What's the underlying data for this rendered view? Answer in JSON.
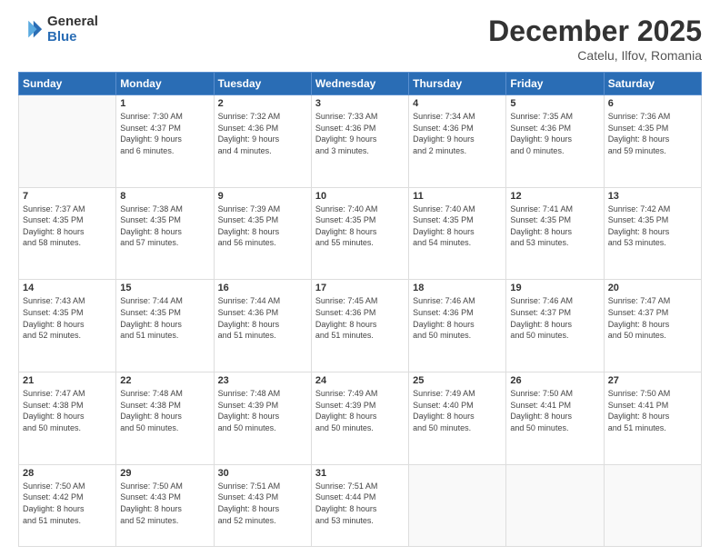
{
  "header": {
    "logo_general": "General",
    "logo_blue": "Blue",
    "month_title": "December 2025",
    "location": "Catelu, Ilfov, Romania"
  },
  "days_of_week": [
    "Sunday",
    "Monday",
    "Tuesday",
    "Wednesday",
    "Thursday",
    "Friday",
    "Saturday"
  ],
  "weeks": [
    [
      {
        "day": "",
        "info": ""
      },
      {
        "day": "1",
        "info": "Sunrise: 7:30 AM\nSunset: 4:37 PM\nDaylight: 9 hours\nand 6 minutes."
      },
      {
        "day": "2",
        "info": "Sunrise: 7:32 AM\nSunset: 4:36 PM\nDaylight: 9 hours\nand 4 minutes."
      },
      {
        "day": "3",
        "info": "Sunrise: 7:33 AM\nSunset: 4:36 PM\nDaylight: 9 hours\nand 3 minutes."
      },
      {
        "day": "4",
        "info": "Sunrise: 7:34 AM\nSunset: 4:36 PM\nDaylight: 9 hours\nand 2 minutes."
      },
      {
        "day": "5",
        "info": "Sunrise: 7:35 AM\nSunset: 4:36 PM\nDaylight: 9 hours\nand 0 minutes."
      },
      {
        "day": "6",
        "info": "Sunrise: 7:36 AM\nSunset: 4:35 PM\nDaylight: 8 hours\nand 59 minutes."
      }
    ],
    [
      {
        "day": "7",
        "info": "Sunrise: 7:37 AM\nSunset: 4:35 PM\nDaylight: 8 hours\nand 58 minutes."
      },
      {
        "day": "8",
        "info": "Sunrise: 7:38 AM\nSunset: 4:35 PM\nDaylight: 8 hours\nand 57 minutes."
      },
      {
        "day": "9",
        "info": "Sunrise: 7:39 AM\nSunset: 4:35 PM\nDaylight: 8 hours\nand 56 minutes."
      },
      {
        "day": "10",
        "info": "Sunrise: 7:40 AM\nSunset: 4:35 PM\nDaylight: 8 hours\nand 55 minutes."
      },
      {
        "day": "11",
        "info": "Sunrise: 7:40 AM\nSunset: 4:35 PM\nDaylight: 8 hours\nand 54 minutes."
      },
      {
        "day": "12",
        "info": "Sunrise: 7:41 AM\nSunset: 4:35 PM\nDaylight: 8 hours\nand 53 minutes."
      },
      {
        "day": "13",
        "info": "Sunrise: 7:42 AM\nSunset: 4:35 PM\nDaylight: 8 hours\nand 53 minutes."
      }
    ],
    [
      {
        "day": "14",
        "info": "Sunrise: 7:43 AM\nSunset: 4:35 PM\nDaylight: 8 hours\nand 52 minutes."
      },
      {
        "day": "15",
        "info": "Sunrise: 7:44 AM\nSunset: 4:35 PM\nDaylight: 8 hours\nand 51 minutes."
      },
      {
        "day": "16",
        "info": "Sunrise: 7:44 AM\nSunset: 4:36 PM\nDaylight: 8 hours\nand 51 minutes."
      },
      {
        "day": "17",
        "info": "Sunrise: 7:45 AM\nSunset: 4:36 PM\nDaylight: 8 hours\nand 51 minutes."
      },
      {
        "day": "18",
        "info": "Sunrise: 7:46 AM\nSunset: 4:36 PM\nDaylight: 8 hours\nand 50 minutes."
      },
      {
        "day": "19",
        "info": "Sunrise: 7:46 AM\nSunset: 4:37 PM\nDaylight: 8 hours\nand 50 minutes."
      },
      {
        "day": "20",
        "info": "Sunrise: 7:47 AM\nSunset: 4:37 PM\nDaylight: 8 hours\nand 50 minutes."
      }
    ],
    [
      {
        "day": "21",
        "info": "Sunrise: 7:47 AM\nSunset: 4:38 PM\nDaylight: 8 hours\nand 50 minutes."
      },
      {
        "day": "22",
        "info": "Sunrise: 7:48 AM\nSunset: 4:38 PM\nDaylight: 8 hours\nand 50 minutes."
      },
      {
        "day": "23",
        "info": "Sunrise: 7:48 AM\nSunset: 4:39 PM\nDaylight: 8 hours\nand 50 minutes."
      },
      {
        "day": "24",
        "info": "Sunrise: 7:49 AM\nSunset: 4:39 PM\nDaylight: 8 hours\nand 50 minutes."
      },
      {
        "day": "25",
        "info": "Sunrise: 7:49 AM\nSunset: 4:40 PM\nDaylight: 8 hours\nand 50 minutes."
      },
      {
        "day": "26",
        "info": "Sunrise: 7:50 AM\nSunset: 4:41 PM\nDaylight: 8 hours\nand 50 minutes."
      },
      {
        "day": "27",
        "info": "Sunrise: 7:50 AM\nSunset: 4:41 PM\nDaylight: 8 hours\nand 51 minutes."
      }
    ],
    [
      {
        "day": "28",
        "info": "Sunrise: 7:50 AM\nSunset: 4:42 PM\nDaylight: 8 hours\nand 51 minutes."
      },
      {
        "day": "29",
        "info": "Sunrise: 7:50 AM\nSunset: 4:43 PM\nDaylight: 8 hours\nand 52 minutes."
      },
      {
        "day": "30",
        "info": "Sunrise: 7:51 AM\nSunset: 4:43 PM\nDaylight: 8 hours\nand 52 minutes."
      },
      {
        "day": "31",
        "info": "Sunrise: 7:51 AM\nSunset: 4:44 PM\nDaylight: 8 hours\nand 53 minutes."
      },
      {
        "day": "",
        "info": ""
      },
      {
        "day": "",
        "info": ""
      },
      {
        "day": "",
        "info": ""
      }
    ]
  ]
}
